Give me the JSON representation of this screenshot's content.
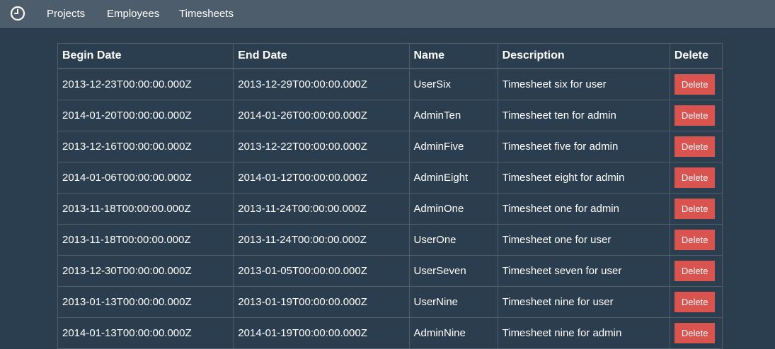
{
  "nav": {
    "brand_icon": "clock-icon",
    "links": [
      "Projects",
      "Employees",
      "Timesheets"
    ]
  },
  "colors": {
    "background": "#2b3e50",
    "navbar": "#4e5d6c",
    "delete": "#d9534f"
  },
  "table": {
    "headers": {
      "begin": "Begin Date",
      "end": "End Date",
      "name": "Name",
      "description": "Description",
      "delete": "Delete"
    },
    "delete_label": "Delete",
    "rows": [
      {
        "begin": "2013-12-23T00:00:00.000Z",
        "end": "2013-12-29T00:00:00.000Z",
        "name": "UserSix",
        "description": "Timesheet six for user"
      },
      {
        "begin": "2014-01-20T00:00:00.000Z",
        "end": "2014-01-26T00:00:00.000Z",
        "name": "AdminTen",
        "description": "Timesheet ten for admin"
      },
      {
        "begin": "2013-12-16T00:00:00.000Z",
        "end": "2013-12-22T00:00:00.000Z",
        "name": "AdminFive",
        "description": "Timesheet five for admin"
      },
      {
        "begin": "2014-01-06T00:00:00.000Z",
        "end": "2014-01-12T00:00:00.000Z",
        "name": "AdminEight",
        "description": "Timesheet eight for admin"
      },
      {
        "begin": "2013-11-18T00:00:00.000Z",
        "end": "2013-11-24T00:00:00.000Z",
        "name": "AdminOne",
        "description": "Timesheet one for admin"
      },
      {
        "begin": "2013-11-18T00:00:00.000Z",
        "end": "2013-11-24T00:00:00.000Z",
        "name": "UserOne",
        "description": "Timesheet one for user"
      },
      {
        "begin": "2013-12-30T00:00:00.000Z",
        "end": "2013-01-05T00:00:00.000Z",
        "name": "UserSeven",
        "description": "Timesheet seven for user"
      },
      {
        "begin": "2013-01-13T00:00:00.000Z",
        "end": "2013-01-19T00:00:00.000Z",
        "name": "UserNine",
        "description": "Timesheet nine for user"
      },
      {
        "begin": "2014-01-13T00:00:00.000Z",
        "end": "2014-01-19T00:00:00.000Z",
        "name": "AdminNine",
        "description": "Timesheet nine for admin"
      }
    ]
  }
}
